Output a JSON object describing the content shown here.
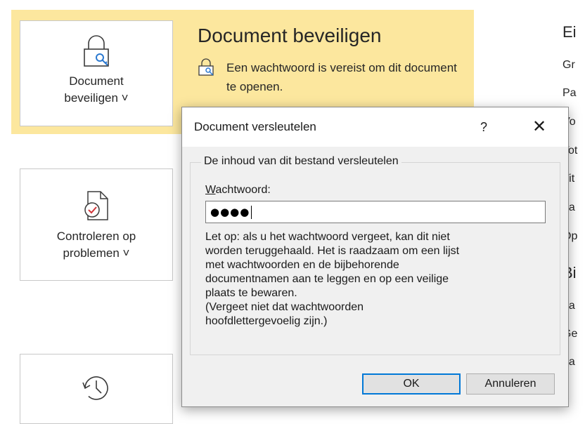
{
  "protect_tile": {
    "line1": "Document",
    "line2": "beveiligen ˅"
  },
  "inspect_tile": {
    "line1": "Controleren op",
    "line2": "problemen ˅"
  },
  "protect_section": {
    "title": "Document beveiligen",
    "description": "Een wachtwoord is vereist om dit document te openen."
  },
  "properties_panel": {
    "heading": "Ei",
    "rows": [
      "Gr",
      "Pa",
      "Vo",
      "Tot",
      "Tit",
      "La",
      "Op"
    ],
    "section2": "Bi",
    "rows2": [
      "La",
      "Ge",
      "La"
    ]
  },
  "dialog": {
    "title": "Document versleutelen",
    "help": "?",
    "close": "✕",
    "group_title": "De inhoud van dit bestand versleutelen",
    "password_label_underline": "W",
    "password_label_rest": "achtwoord:",
    "password_value": "●●●●",
    "warning_lines": [
      "Let op: als u het wachtwoord vergeet, kan dit niet",
      "worden teruggehaald. Het is raadzaam om een lijst",
      "met wachtwoorden en de bijbehorende",
      "documentnamen aan te leggen en op een veilige",
      "plaats te bewaren.",
      "(Vergeet niet dat wachtwoorden",
      "hoofdlettergevoelig zijn.)"
    ],
    "ok_label": "OK",
    "cancel_label": "Annuleren"
  },
  "colors": {
    "highlight": "#fce79e",
    "accent": "#0078d7",
    "icon_red": "#d13438",
    "icon_blue": "#2b79d0"
  },
  "icons": {
    "protect": "lock-key-icon",
    "inspect": "document-check-icon",
    "history": "history-icon",
    "protect_small": "lock-key-small-icon"
  }
}
